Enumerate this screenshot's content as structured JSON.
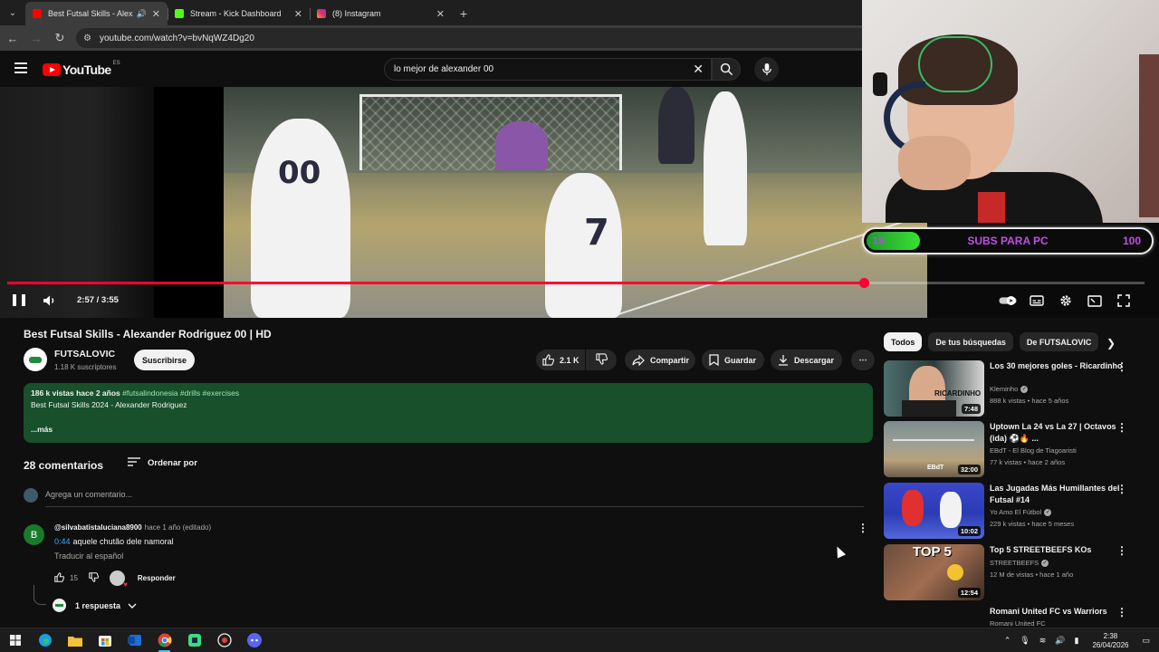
{
  "browser": {
    "tabs": [
      {
        "title": "Best Futsal Skills - Alexander",
        "active": true,
        "favicon_color": "#ff0000",
        "audio": true
      },
      {
        "title": "Stream - Kick Dashboard",
        "active": false,
        "favicon_color": "#53fc18"
      },
      {
        "title": "(8) Instagram",
        "active": false,
        "favicon_color": "#e1306c"
      }
    ],
    "new_tab": "+",
    "url": "youtube.com/watch?v=bvNqWZ4Dg20"
  },
  "masthead": {
    "logo_text": "YouTube",
    "country_code": "ES",
    "search_value": "lo mejor de alexander 00"
  },
  "player": {
    "time": "2:57 / 3:55",
    "progress_fraction": 0.7532,
    "jersey_numbers": [
      "00",
      "7"
    ]
  },
  "overlay": {
    "subs_label": "SUBS PARA PC",
    "current": "19",
    "goal": "100",
    "progress_fraction": 0.19
  },
  "video": {
    "title": "Best Futsal Skills - Alexander Rodriguez 00 | HD",
    "channel": "FUTSALOVIC",
    "subscribers": "1.18 K suscriptores",
    "subscribe_label": "Suscribirse",
    "likes": "2.1 K",
    "share_label": "Compartir",
    "save_label": "Guardar",
    "download_label": "Descargar",
    "description": {
      "stats": "186 k vistas  hace 2 años",
      "tags": "#futsalindonesia #drills #exercises",
      "line2": "Best Futsal Skills 2024 - Alexander Rodriguez",
      "more": "...más"
    }
  },
  "comments": {
    "count_label": "28 comentarios",
    "sort_label": "Ordenar por",
    "add_placeholder": "Agrega un comentario...",
    "items": [
      {
        "avatar_letter": "B",
        "author": "@silvabatistaluciana8900",
        "time": "hace 1 año (editado)",
        "timestamp": "0:44",
        "text": "aquele chutão dele namoral",
        "translate": "Traducir al español",
        "likes": "15",
        "reply_label": "Responder",
        "replies_label": "1 respuesta"
      }
    ]
  },
  "sidebar": {
    "chips": [
      "Todos",
      "De tus búsquedas",
      "De FUTSALOVIC"
    ],
    "recommendations": [
      {
        "title": "Los 30 mejores goles - Ricardinho",
        "channel": "Kleminho",
        "verified": true,
        "meta": "888 k vistas • hace 5 años",
        "duration": "7:48",
        "thumb_text": "RICARDINHO"
      },
      {
        "title": "Uptown La 24 vs La 27 | Octavos (ida) ⚽🔥 ...",
        "channel": "EBdT - El Blog de Tiagoaristi",
        "verified": false,
        "meta": "77 k vistas • hace 2 años",
        "duration": "32:00",
        "thumb_text": "EBdT"
      },
      {
        "title": "Las Jugadas Más Humillantes del Futsal #14",
        "channel": "Yo Amo El Fútbol",
        "verified": true,
        "meta": "229 k vistas • hace 5 meses",
        "duration": "10:02",
        "thumb_text": ""
      },
      {
        "title": "Top 5 STREETBEEFS KOs",
        "channel": "STREETBEEFS",
        "verified": true,
        "meta": "12 M de vistas • hace 1 año",
        "duration": "12:54",
        "thumb_text": "TOP 5"
      },
      {
        "title": "Romani United FC vs Warriors",
        "channel": "Romani United FC",
        "verified": false,
        "meta": "",
        "duration": "",
        "thumb_text": ""
      }
    ]
  },
  "taskbar": {
    "time": "2:38",
    "date": "26/04/2026"
  }
}
